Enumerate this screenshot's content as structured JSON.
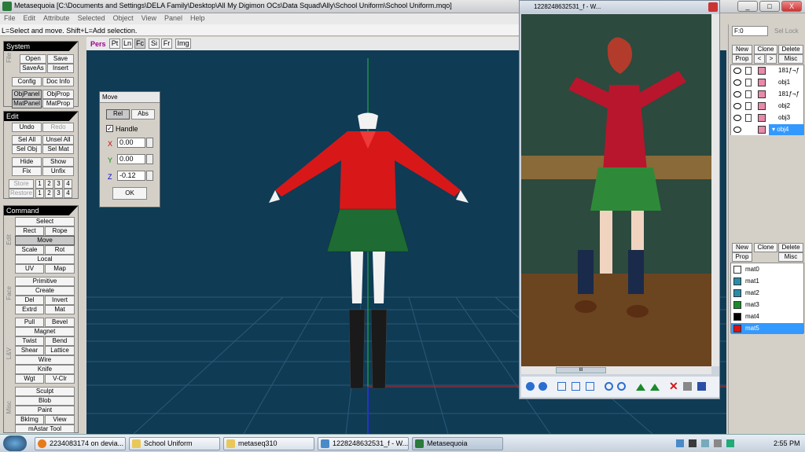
{
  "window": {
    "title": "Metasequoia [C:\\Documents and Settings\\DELA Family\\Desktop\\All My Digimon OCs\\Data Squad\\Ally\\School Uniform\\School Uniform.mqo]",
    "min": "_",
    "max": "□",
    "close": "X"
  },
  "menu": [
    "File",
    "Edit",
    "Attribute",
    "Selected",
    "Object",
    "View",
    "Panel",
    "Help"
  ],
  "hint": "L=Select and move.  Shift+L=Add selection.",
  "system": {
    "title": "System",
    "side": "File",
    "open": "Open",
    "save": "Save",
    "saveas": "SaveAs",
    "insert": "Insert",
    "config": "Config",
    "docinfo": "Doc Info",
    "objpanel": "ObjPanel",
    "objprop": "ObjProp",
    "matpanel": "MatPanel",
    "matprop": "MatProp"
  },
  "edit": {
    "title": "Edit",
    "undo": "Undo",
    "redo": "Redo",
    "selall": "Sel All",
    "unselall": "Unsel All",
    "selobj": "Sel Obj",
    "selmat": "Sel Mat",
    "hide": "Hide",
    "show": "Show",
    "fix": "Fix",
    "unfix": "Unfix",
    "store": "Store",
    "restore": "Restore",
    "n1": "1",
    "n2": "2",
    "n3": "3",
    "n4": "4"
  },
  "command": {
    "title": "Command",
    "edit": "Edit",
    "face": "Face",
    "lv": "L&V",
    "misc": "Misc",
    "select": "Select",
    "rect": "Rect",
    "rope": "Rope",
    "move": "Move",
    "scale": "Scale",
    "rot": "Rot",
    "local": "Local",
    "uv": "UV",
    "map": "Map",
    "primitive": "Primitive",
    "create": "Create",
    "del": "Del",
    "invert": "Invert",
    "extrd": "Extrd",
    "mat": "Mat",
    "pull": "Pull",
    "bevel": "Bevel",
    "magnet": "Magnet",
    "twist": "Twist",
    "bend": "Bend",
    "shear": "Shear",
    "lattice": "Lattice",
    "wire": "Wire",
    "knife": "Knife",
    "wgt": "Wgt",
    "vclr": "V-Clr",
    "sculpt": "Sculpt",
    "blob": "Blob",
    "paint": "Paint",
    "bkimg": "BkImg",
    "view": "View",
    "mastar": "mAstar Tool"
  },
  "viewtabs": [
    "Pers",
    "Pt",
    "Ln",
    "Fc",
    "Si",
    "Fr",
    "Img"
  ],
  "move": {
    "title": "Move",
    "rel": "Rel",
    "abs": "Abs",
    "handle": "Handle",
    "xl": "X",
    "yl": "Y",
    "zl": "Z",
    "x": "0.00",
    "y": "0.00",
    "z": "-0.12",
    "ok": "OK"
  },
  "imagewin": {
    "title": "1228248632531_f - W...",
    "scroll": "III"
  },
  "rightpanel": {
    "frame": "F:0",
    "sellock": "Sel Lock",
    "new": "New",
    "clone": "Clone",
    "delete": "Delete",
    "prop": "Prop",
    "lt": "<",
    "gt": ">",
    "misc": "Misc",
    "objects": [
      "181ƒ¬ƒ",
      "obj1",
      "181ƒ¬ƒ",
      "obj2",
      "obj3",
      "obj4"
    ],
    "materials": [
      {
        "name": "mat0",
        "color": "#ffffff"
      },
      {
        "name": "mat1",
        "color": "#2a8ca8"
      },
      {
        "name": "mat2",
        "color": "#2a8ca8"
      },
      {
        "name": "mat3",
        "color": "#1a8a2a"
      },
      {
        "name": "mat4",
        "color": "#000000"
      },
      {
        "name": "mat5",
        "color": "#e01010"
      }
    ]
  },
  "taskbar": {
    "items": [
      "2234083174 on devia...",
      "School Uniform",
      "metaseq310",
      "1228248632531_f - W...",
      "Metasequoia"
    ],
    "time": "2:55 PM"
  },
  "colors": {
    "viewport": "#0f3b55",
    "jacket": "#d81818",
    "skirt": "#1e6b34",
    "selection": "#3399ff"
  }
}
